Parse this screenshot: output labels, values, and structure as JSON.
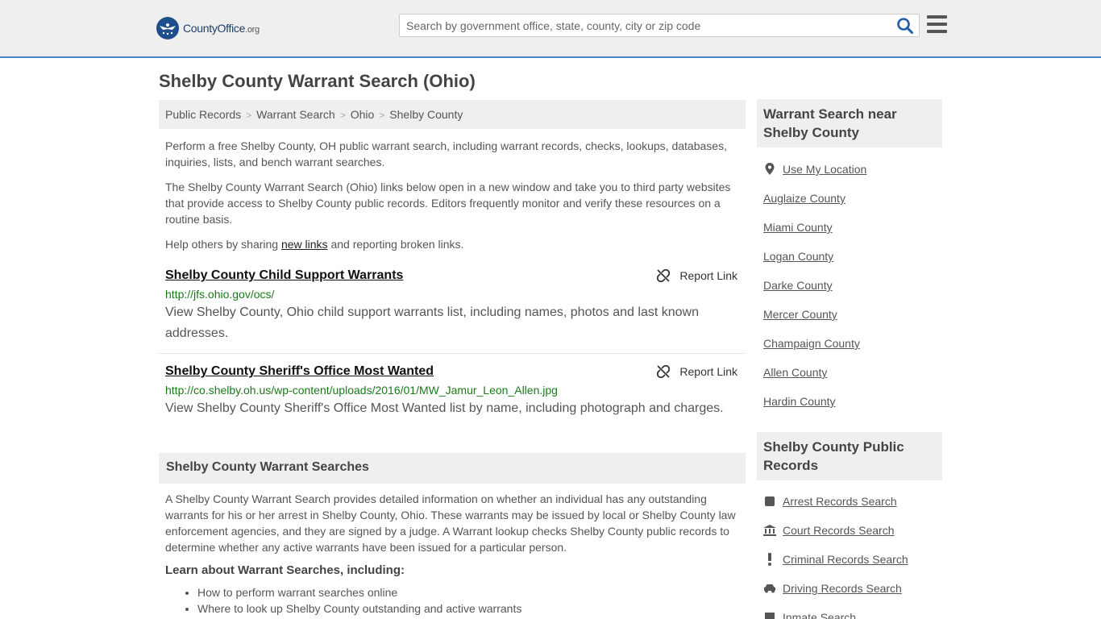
{
  "header": {
    "logo_text": "CountyOffice",
    "logo_suffix": ".org",
    "search_placeholder": "Search by government office, state, county, city or zip code"
  },
  "page": {
    "title": "Shelby County Warrant Search (Ohio)"
  },
  "breadcrumb": [
    "Public Records",
    "Warrant Search",
    "Ohio",
    "Shelby County"
  ],
  "intro": {
    "p1": "Perform a free Shelby County, OH public warrant search, including warrant records, checks, lookups, databases, inquiries, lists, and bench warrant searches.",
    "p2": "The Shelby County Warrant Search (Ohio) links below open in a new window and take you to third party websites that provide access to Shelby County public records. Editors frequently monitor and verify these resources on a routine basis.",
    "p3_before": "Help others by sharing ",
    "p3_link": "new links",
    "p3_after": " and reporting broken links."
  },
  "links": [
    {
      "title": "Shelby County Child Support Warrants",
      "report": "Report Link",
      "url": "http://jfs.ohio.gov/ocs/",
      "desc": "View Shelby County, Ohio child support warrants list, including names, photos and last known addresses."
    },
    {
      "title": "Shelby County Sheriff's Office Most Wanted",
      "report": "Report Link",
      "url": "http://co.shelby.oh.us/wp-content/uploads/2016/01/MW_Jamur_Leon_Allen.jpg",
      "desc": "View Shelby County Sheriff's Office Most Wanted list by name, including photograph and charges."
    }
  ],
  "section": {
    "heading": "Shelby County Warrant Searches",
    "body": "A Shelby County Warrant Search provides detailed information on whether an individual has any outstanding warrants for his or her arrest in Shelby County, Ohio. These warrants may be issued by local or Shelby County law enforcement agencies, and they are signed by a judge. A Warrant lookup checks Shelby County public records to determine whether any active warrants have been issued for a particular person.",
    "learn": "Learn about Warrant Searches, including:",
    "bullets": [
      "How to perform warrant searches online",
      "Where to look up Shelby County outstanding and active warrants"
    ]
  },
  "sidebar": {
    "near_heading": "Warrant Search near Shelby County",
    "use_location": "Use My Location",
    "near_items": [
      "Auglaize County",
      "Miami County",
      "Logan County",
      "Darke County",
      "Mercer County",
      "Champaign County",
      "Allen County",
      "Hardin County"
    ],
    "records_heading": "Shelby County Public Records",
    "records_items": [
      "Arrest Records Search",
      "Court Records Search",
      "Criminal Records Search",
      "Driving Records Search",
      "Inmate Search"
    ]
  }
}
